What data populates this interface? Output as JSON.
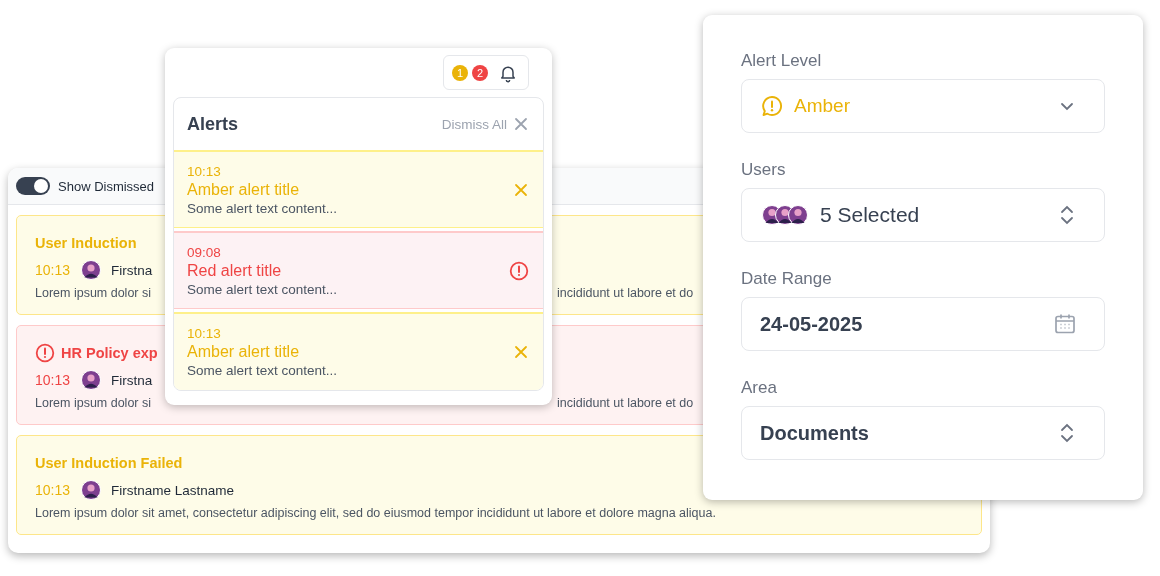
{
  "list_panel": {
    "toggle": {
      "label": "Show Dismissed",
      "on": true
    },
    "cards": [
      {
        "kind": "amber",
        "title": "User Induction",
        "time": "10:13",
        "user": "Firstna",
        "body_left": "Lorem ipsum dolor si",
        "body_right": "incididunt ut labore et do"
      },
      {
        "kind": "red",
        "title": "HR Policy exp",
        "time": "10:13",
        "user": "Firstna",
        "body_left": "Lorem ipsum dolor si",
        "body_right": "incididunt ut labore et do"
      },
      {
        "kind": "amber",
        "title": "User Induction Failed",
        "time": "10:13",
        "user": "Firstname Lastname",
        "body_left": "Lorem ipsum dolor sit amet, consectetur adipiscing elit, sed do eiusmod tempor incididunt ut labore et dolore magna aliqua."
      }
    ]
  },
  "alerts_popup": {
    "badges": [
      {
        "kind": "amber",
        "count": "1"
      },
      {
        "kind": "red",
        "count": "2"
      }
    ],
    "title": "Alerts",
    "dismiss_all": "Dismiss All",
    "items": [
      {
        "kind": "amber",
        "time": "10:13",
        "title": "Amber alert title",
        "text": "Some alert text content..."
      },
      {
        "kind": "red",
        "time": "09:08",
        "title": "Red alert title",
        "text": "Some alert text content..."
      },
      {
        "kind": "amber",
        "time": "10:13",
        "title": "Amber alert title",
        "text": "Some alert text content..."
      }
    ]
  },
  "filter_panel": {
    "fields": [
      {
        "kind": "level",
        "label": "Alert Level",
        "value": "Amber",
        "color": "#eab308"
      },
      {
        "kind": "users",
        "label": "Users",
        "value": "5 Selected"
      },
      {
        "kind": "date",
        "label": "Date Range",
        "value": "24-05-2025"
      },
      {
        "kind": "select",
        "label": "Area",
        "value": "Documents"
      }
    ]
  }
}
